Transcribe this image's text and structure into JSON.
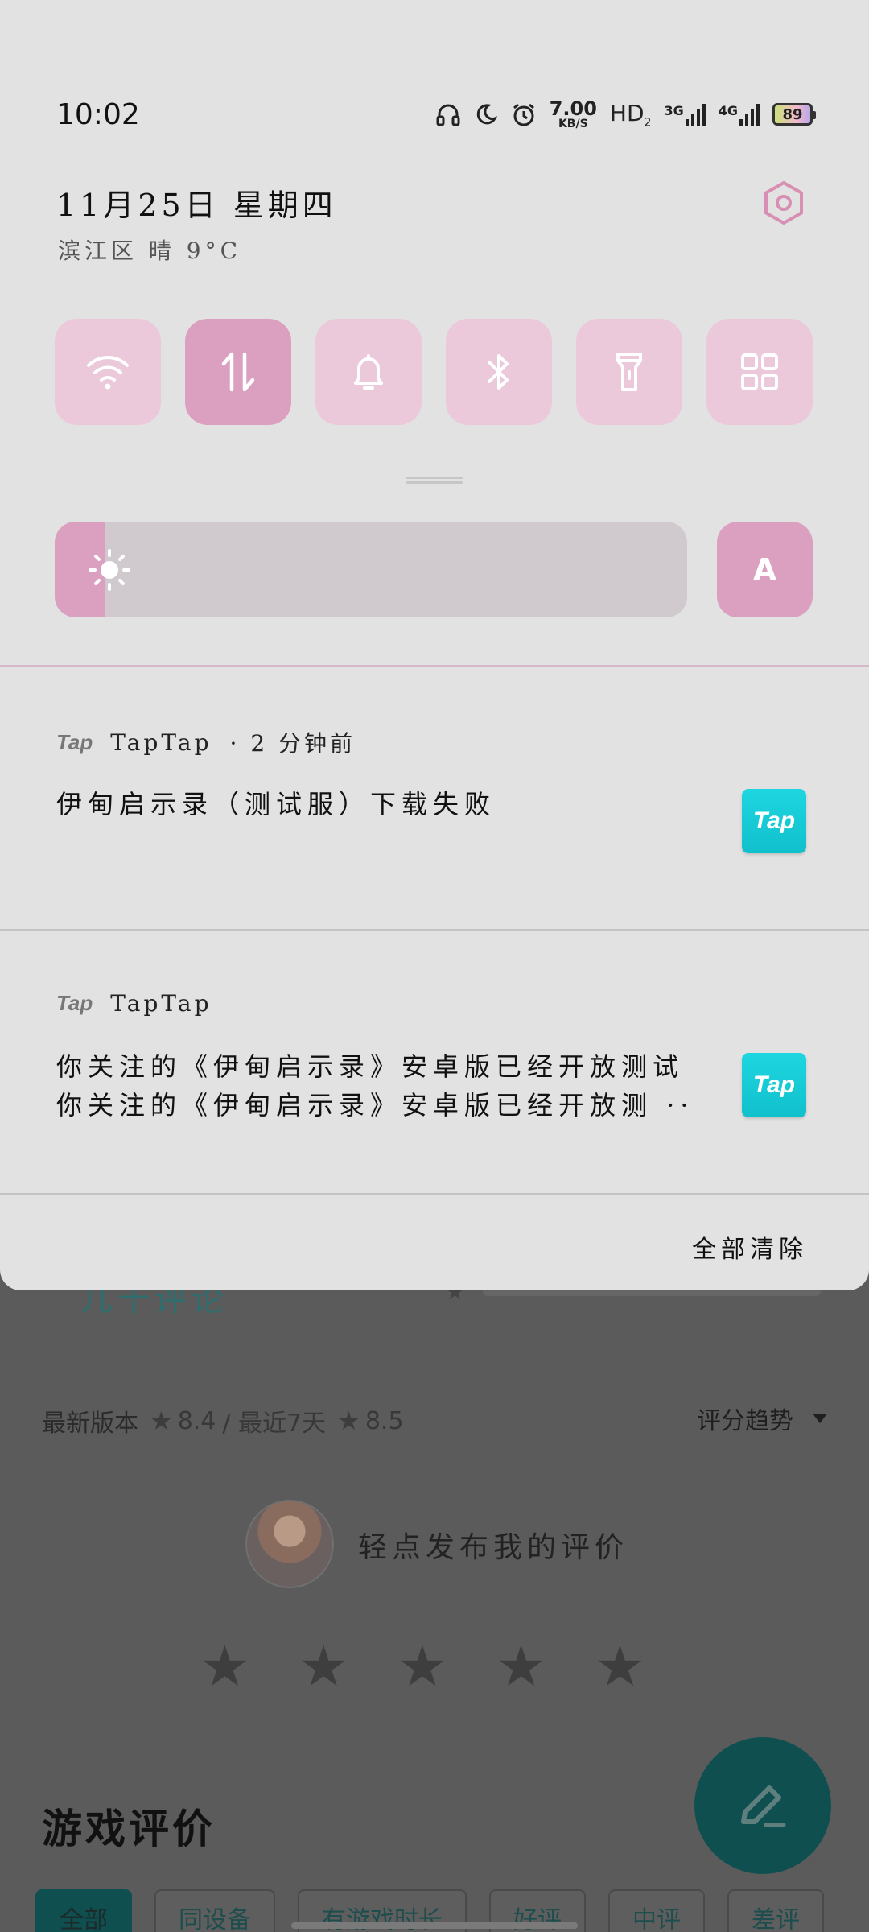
{
  "status_bar": {
    "time": "10:02",
    "net_speed_value": "7.00",
    "net_speed_unit": "KB/S",
    "hd_label": "HD",
    "hd_sub": "2",
    "sim1_label": "3G",
    "sim2_label": "4G",
    "battery_level": "89",
    "icons": [
      "headphones-icon",
      "moon-icon",
      "alarm-icon"
    ]
  },
  "header": {
    "date": "11月25日  星期四",
    "weather": "滨江区 晴 9°C",
    "settings_icon": "settings-icon"
  },
  "quick_tiles": [
    {
      "name": "wifi",
      "icon": "wifi-icon",
      "active": false
    },
    {
      "name": "mobile-data",
      "icon": "data-arrows-icon",
      "active": true
    },
    {
      "name": "sound",
      "icon": "bell-icon",
      "active": false
    },
    {
      "name": "bluetooth",
      "icon": "bluetooth-icon",
      "active": false
    },
    {
      "name": "flashlight",
      "icon": "flashlight-icon",
      "active": false
    },
    {
      "name": "more",
      "icon": "grid-icon",
      "active": false
    }
  ],
  "brightness": {
    "level": 0.08,
    "auto_label": "A"
  },
  "notifications": [
    {
      "app_logo": "Tap",
      "app_name": "TapTap",
      "time": "·  2 分钟前",
      "text": "伊甸启示录（测试服）下载失败",
      "icon_label": "Tap"
    },
    {
      "app_logo": "Tap",
      "app_name": "TapTap",
      "line1": "你关注的《伊甸启示录》安卓版已经开放测试",
      "line2": "你关注的《伊甸启示录》安卓版已经开放测 ··",
      "icon_label": "Tap"
    }
  ],
  "clear_all_label": "全部清除",
  "background_app": {
    "partial_text": "几十评论",
    "version_label": "最新版本",
    "version_rating": "8.4",
    "recent_label": "/ 最近7天",
    "recent_rating": "8.5",
    "trend_label": "评分趋势",
    "post_review_label": "轻点发布我的评价",
    "section_title": "游戏评价",
    "filters": [
      "全部",
      "同设备",
      "有游戏时长",
      "好评",
      "中评",
      "差评"
    ],
    "accent_color": "#0f4f50"
  },
  "colors": {
    "tile": "#ebc8da",
    "tile_active": "#dba0c0",
    "shade_bg": "#e2e2e2",
    "tap_brand": "#14c8d4"
  }
}
